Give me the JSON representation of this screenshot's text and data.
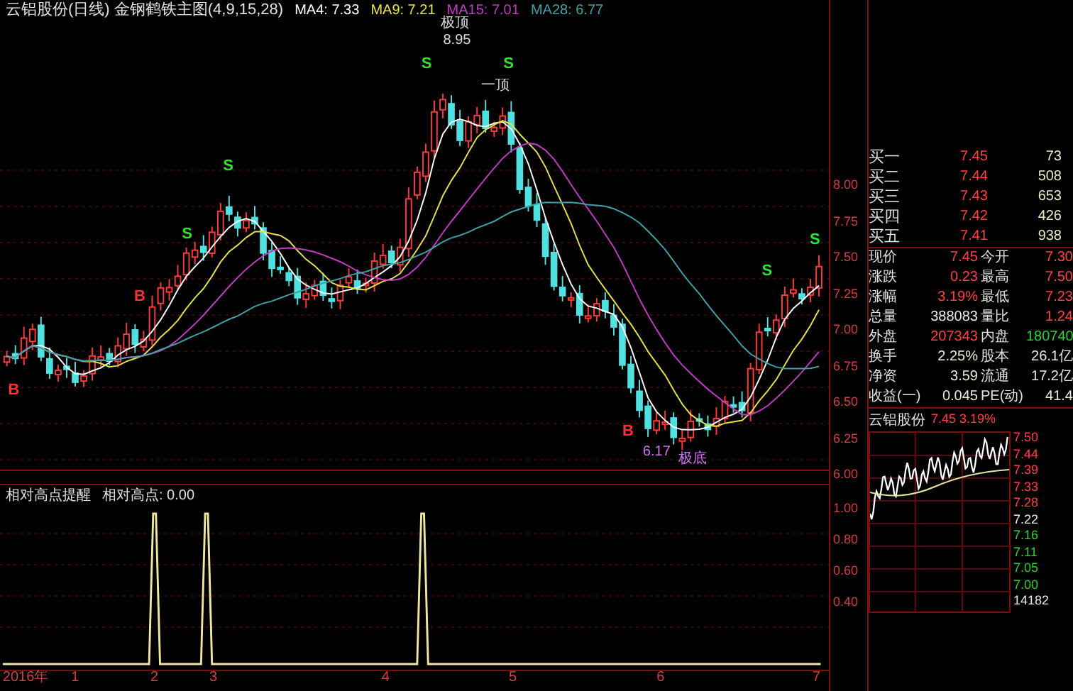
{
  "title": {
    "text": "云铝股份(日线) 金钢鹤铁主图(4,9,15,28)"
  },
  "moving_averages": [
    {
      "label": "MA4: 7.33",
      "color": "#ffffff"
    },
    {
      "label": "MA9: 7.21",
      "color": "#e8e04a"
    },
    {
      "label": "MA15: 7.01",
      "color": "#c03cc0"
    },
    {
      "label": "MA28: 6.77",
      "color": "#3fa0a8"
    }
  ],
  "price_axis": [
    "8.00",
    "7.75",
    "7.50",
    "7.25",
    "7.00",
    "6.75",
    "6.50",
    "6.25",
    "6.00"
  ],
  "signals": [
    {
      "kind": "buy",
      "label": "B"
    },
    {
      "kind": "buy",
      "label": "B"
    },
    {
      "kind": "sell",
      "label": "S"
    },
    {
      "kind": "sell",
      "label": "S"
    },
    {
      "kind": "sell",
      "label": "S"
    },
    {
      "kind": "sell",
      "label": "S"
    },
    {
      "kind": "buy",
      "label": "B"
    },
    {
      "kind": "sell",
      "label": "S"
    },
    {
      "kind": "sell",
      "label": "S"
    }
  ],
  "annotations": [
    {
      "kind": "peak",
      "text": "极顶"
    },
    {
      "kind": "peak",
      "text": "8.95"
    },
    {
      "kind": "top",
      "text": "一顶"
    },
    {
      "kind": "bottom",
      "text": "6.17"
    },
    {
      "kind": "bottom",
      "text": "极底"
    }
  ],
  "indicator": {
    "title": "相对高点提醒",
    "reading": "相对高点: 0.00",
    "axis": [
      "1.00",
      "0.80",
      "0.60",
      "0.40"
    ]
  },
  "time_axis": [
    "2016年",
    "1",
    "2",
    "3",
    "4",
    "5",
    "6",
    "7"
  ],
  "order_book": [
    {
      "label": "买一",
      "price": "7.45",
      "volume": "73"
    },
    {
      "label": "买二",
      "price": "7.44",
      "volume": "508"
    },
    {
      "label": "买三",
      "price": "7.43",
      "volume": "653"
    },
    {
      "label": "买四",
      "price": "7.42",
      "volume": "426"
    },
    {
      "label": "买五",
      "price": "7.41",
      "volume": "938"
    }
  ],
  "quote": [
    [
      {
        "label": "现价",
        "value": "7.45",
        "color": "#ff4040"
      },
      {
        "label": "今开",
        "value": "7.30",
        "color": "#ff4040"
      }
    ],
    [
      {
        "label": "涨跌",
        "value": "0.23",
        "color": "#ff4040"
      },
      {
        "label": "最高",
        "value": "7.50",
        "color": "#ff4040"
      }
    ],
    [
      {
        "label": "涨幅",
        "value": "3.19%",
        "color": "#ff4040"
      },
      {
        "label": "最低",
        "value": "7.23",
        "color": "#ff4040"
      }
    ],
    [
      {
        "label": "总量",
        "value": "388083",
        "color": "#e8e8d8"
      },
      {
        "label": "量比",
        "value": "1.24",
        "color": "#ff4040"
      }
    ],
    [
      {
        "label": "外盘",
        "value": "207343",
        "color": "#ff4040"
      },
      {
        "label": "内盘",
        "value": "180740",
        "color": "#30d030"
      }
    ],
    [
      {
        "label": "换手",
        "value": "2.25%",
        "color": "#e8e8d8"
      },
      {
        "label": "股本",
        "value": "26.1亿",
        "color": "#e8e8d8"
      }
    ],
    [
      {
        "label": "净资",
        "value": "3.59",
        "color": "#e8e8d8"
      },
      {
        "label": "流通",
        "value": "17.2亿",
        "color": "#e8e8d8"
      }
    ],
    [
      {
        "label": "收益(一)",
        "value": "0.045",
        "color": "#e8e8d8"
      },
      {
        "label": "PE(动)",
        "value": "41.4",
        "color": "#e8e8d8"
      }
    ]
  ],
  "mini_chart": {
    "name": "云铝股份",
    "reading": "7.45 3.19%",
    "axis": [
      {
        "text": "7.50",
        "color": "#ff4040"
      },
      {
        "text": "7.44",
        "color": "#ff4040"
      },
      {
        "text": "7.39",
        "color": "#ff4040"
      },
      {
        "text": "7.33",
        "color": "#ff4040"
      },
      {
        "text": "7.28",
        "color": "#ff4040"
      },
      {
        "text": "7.22",
        "color": "#e8e8d8"
      },
      {
        "text": "7.16",
        "color": "#30d030"
      },
      {
        "text": "7.11",
        "color": "#30d030"
      },
      {
        "text": "7.05",
        "color": "#30d030"
      },
      {
        "text": "7.00",
        "color": "#30d030"
      },
      {
        "text": "14182",
        "color": "#e8e8d8"
      }
    ]
  }
}
